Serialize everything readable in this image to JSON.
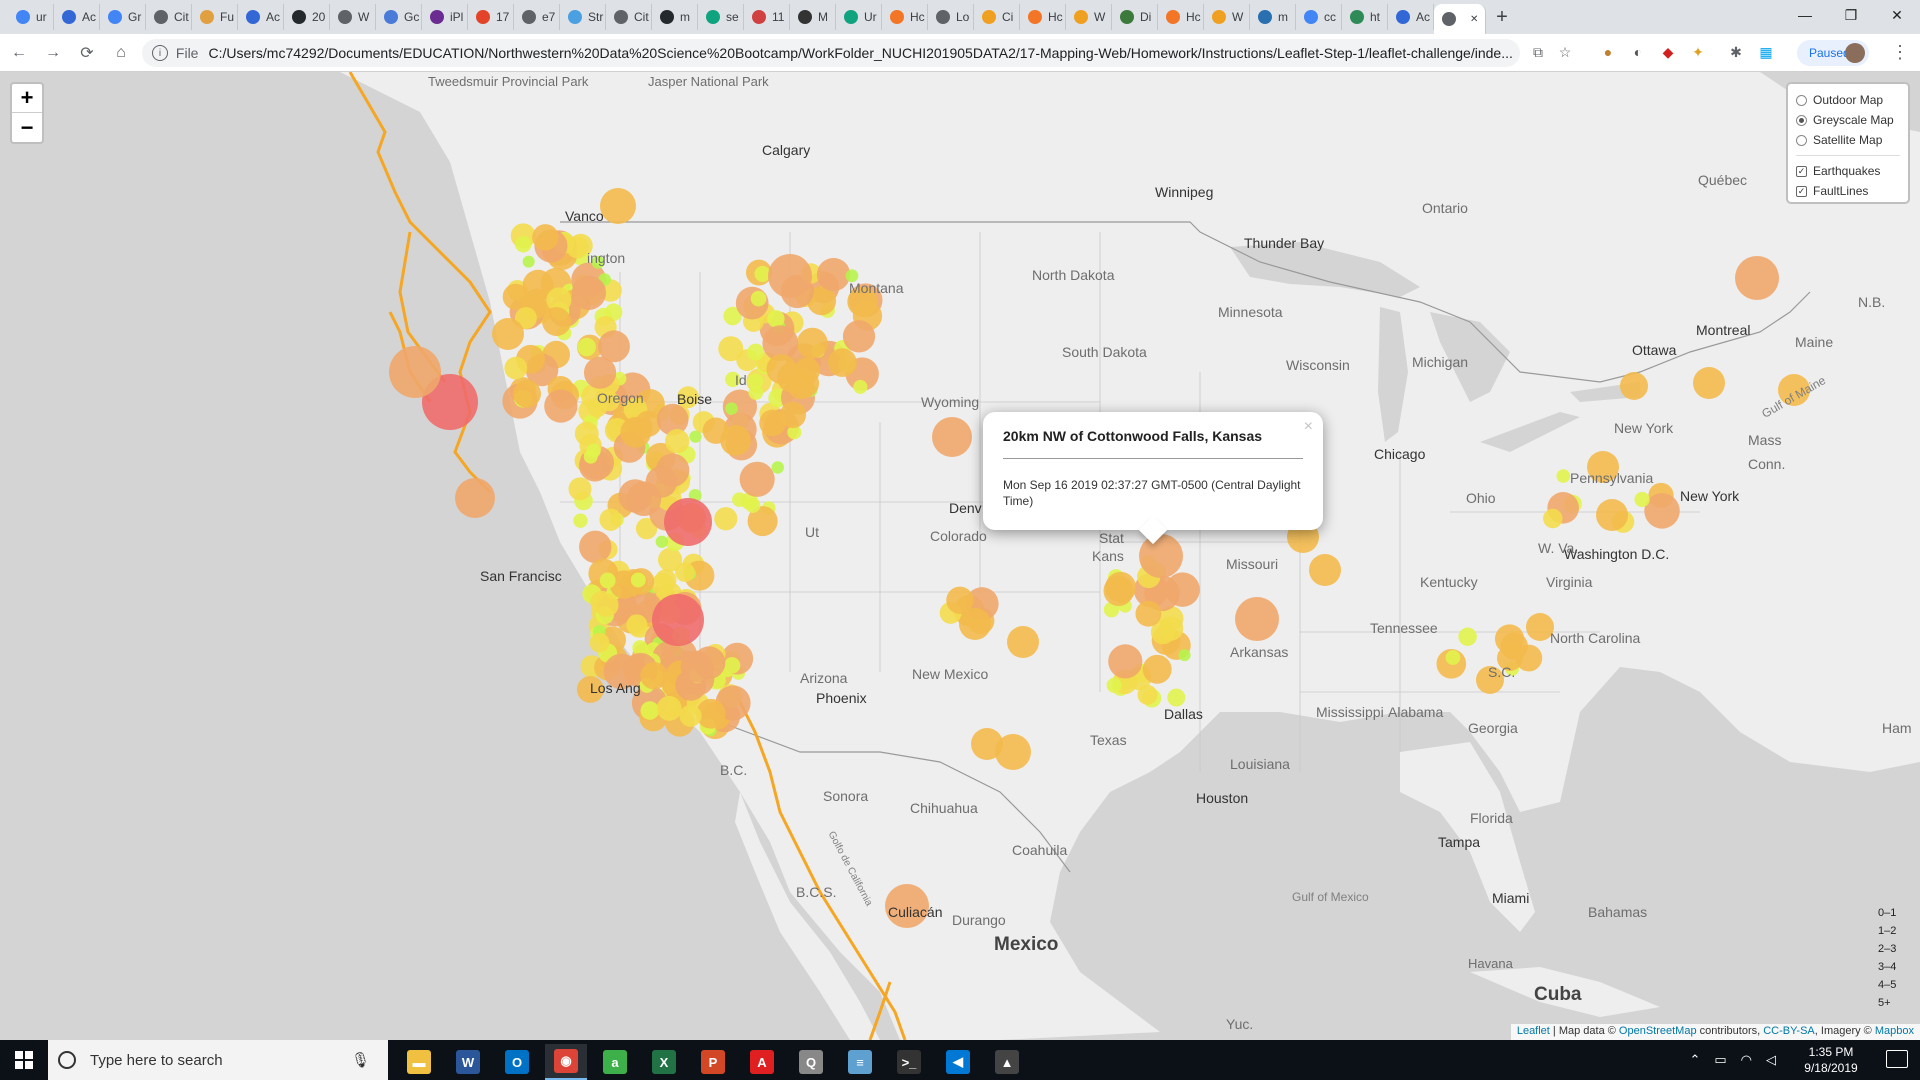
{
  "browser": {
    "tabs": [
      {
        "label": "ur",
        "icon": "google-icon",
        "color": "#4285f4"
      },
      {
        "label": "Ac",
        "icon": "chrome-icon",
        "color": "#3367d6"
      },
      {
        "label": "Gr",
        "icon": "google-icon",
        "color": "#4285f4"
      },
      {
        "label": "Cit",
        "icon": "globe-icon",
        "color": "#5f6368"
      },
      {
        "label": "Fu",
        "icon": "tab-icon",
        "color": "#e0a040"
      },
      {
        "label": "Ac",
        "icon": "chrome-icon",
        "color": "#3367d6"
      },
      {
        "label": "20",
        "icon": "github-icon",
        "color": "#24292e"
      },
      {
        "label": "W",
        "icon": "globe-icon",
        "color": "#5f6368"
      },
      {
        "label": "Gc",
        "icon": "google-docs-icon",
        "color": "#4a7bd8"
      },
      {
        "label": "iPl",
        "icon": "ipl-icon",
        "color": "#6a2c91"
      },
      {
        "label": "17",
        "icon": "gitlab-icon",
        "color": "#e24329"
      },
      {
        "label": "e7",
        "icon": "globe-icon",
        "color": "#5f6368"
      },
      {
        "label": "Str",
        "icon": "chart-icon",
        "color": "#4aa0e0"
      },
      {
        "label": "Cit",
        "icon": "globe-icon",
        "color": "#5f6368"
      },
      {
        "label": "m",
        "icon": "github-icon",
        "color": "#24292e"
      },
      {
        "label": "se",
        "icon": "openai-icon",
        "color": "#10a37f"
      },
      {
        "label": "11",
        "icon": "tab-icon",
        "color": "#d04040"
      },
      {
        "label": "M",
        "icon": "book-icon",
        "color": "#333333"
      },
      {
        "label": "Ur",
        "icon": "openai-icon",
        "color": "#10a37f"
      },
      {
        "label": "Hc",
        "icon": "jupyter-icon",
        "color": "#f37626"
      },
      {
        "label": "Lo",
        "icon": "globe-icon",
        "color": "#5f6368"
      },
      {
        "label": "Ci",
        "icon": "tab-icon",
        "color": "#f0a020"
      },
      {
        "label": "Hc",
        "icon": "jupyter-icon",
        "color": "#f37626"
      },
      {
        "label": "W",
        "icon": "tab-icon",
        "color": "#f0a020"
      },
      {
        "label": "Di",
        "icon": "tab-icon",
        "color": "#3c7a3c"
      },
      {
        "label": "Hc",
        "icon": "jupyter-icon",
        "color": "#f37626"
      },
      {
        "label": "W",
        "icon": "tab-icon",
        "color": "#f0a020"
      },
      {
        "label": "m",
        "icon": "tab-icon",
        "color": "#2a6fb0"
      },
      {
        "label": "cc",
        "icon": "google-icon",
        "color": "#4285f4"
      },
      {
        "label": "ht",
        "icon": "tab-icon",
        "color": "#2e8b57"
      },
      {
        "label": "Ac",
        "icon": "chrome-icon",
        "color": "#3367d6"
      },
      {
        "label": "",
        "icon": "globe-icon",
        "color": "#5f6368"
      }
    ],
    "new_tab": "+",
    "window_controls": {
      "minimize": "—",
      "maximize": "❐",
      "close": "✕"
    },
    "address": {
      "scheme": "File",
      "url": "C:/Users/mc74292/Documents/EDUCATION/Northwestern%20Data%20Science%20Bootcamp/WorkFolder_NUCHI201905DATA2/17-Mapping-Web/Homework/Instructions/Leaflet-Step-1/leaflet-challenge/inde..."
    },
    "profile": {
      "status": "Paused"
    }
  },
  "map": {
    "zoom_in": "+",
    "zoom_out": "−",
    "layer_control": {
      "base_layers": [
        {
          "label": "Outdoor Map",
          "selected": false
        },
        {
          "label": "Greyscale Map",
          "selected": true
        },
        {
          "label": "Satellite Map",
          "selected": false
        }
      ],
      "overlays": [
        {
          "label": "Earthquakes",
          "checked": true
        },
        {
          "label": "FaultLines",
          "checked": true
        }
      ]
    },
    "popup": {
      "title": "20km NW of Cottonwood Falls, Kansas",
      "time": "Mon Sep 16 2019 02:37:27 GMT-0500 (Central Daylight Time)",
      "close": "×"
    },
    "legend": [
      "0–1",
      "1–2",
      "2–3",
      "3–4",
      "4–5",
      "5+"
    ],
    "legend_colors": [
      "#b7f34d",
      "#e1f34d",
      "#f3db4d",
      "#f3ba4d",
      "#f0a76b",
      "#f06b6b"
    ],
    "attribution": {
      "leaflet": "Leaflet",
      "text": " | Map data © ",
      "osm": "OpenStreetMap",
      "contrib": " contributors, ",
      "license": "CC-BY-SA",
      "imagery": ", Imagery © ",
      "mapbox": "Mapbox"
    },
    "labels": {
      "tweedsmuir": "Tweedsmuir Provincial Park",
      "jasper": "Jasper National Park",
      "calgary": "Calgary",
      "winnipeg": "Winnipeg",
      "vancouver": "Vanco",
      "washington": "ington",
      "montana": "Montana",
      "north_dakota": "North Dakota",
      "minnesota": "Minnesota",
      "south_dakota": "South Dakota",
      "wisconsin": "Wisconsin",
      "michigan": "Michigan",
      "thunder_bay": "Thunder Bay",
      "ontario": "Ontario",
      "quebec": "Québec",
      "montreal": "Montreal",
      "ottawa": "Ottawa",
      "maine": "Maine",
      "nb": "N.B.",
      "oregon": "Oregon",
      "boise": "Boise",
      "idaho": "Id",
      "wyoming": "Wyoming",
      "denver": "Denv",
      "colorado": "Colorado",
      "kansas": "Kans",
      "state": "Stat",
      "missouri": "Missouri",
      "chicago": "Chicago",
      "ohio": "Ohio",
      "pennsylvania": "Pennsylvania",
      "new_york_state": "New York",
      "new_york": "New York",
      "mass": "Mass",
      "conn": "Conn.",
      "gulf_maine": "Gulf of Maine",
      "washington_dc": "Washington D.C.",
      "wva": "W. Va.",
      "virginia": "Virginia",
      "kentucky": "Kentucky",
      "tennessee": "Tennessee",
      "north_carolina": "North Carolina",
      "sc": "S.C.",
      "georgia": "Georgia",
      "arkansas": "Arkansas",
      "mississippi": "Mississippi",
      "alabama": "Alabama",
      "louisiana": "Louisiana",
      "dallas": "Dallas",
      "houston": "Houston",
      "texas": "Texas",
      "new_mexico": "New Mexico",
      "arizona": "Arizona",
      "phoenix": "Phoenix",
      "san_francisco": "San Francisc",
      "los_angeles": "Los Ang",
      "bc": "B.C.",
      "bcs": "B.C.S.",
      "sonora": "Sonora",
      "chihuahua": "Chihuahua",
      "coahuila": "Coahuila",
      "culiacan": "Culiacán",
      "durango": "Durango",
      "mexico": "Mexico",
      "tampa": "Tampa",
      "florida": "Florida",
      "miami": "Miami",
      "bahamas": "Bahamas",
      "havana": "Havana",
      "cuba": "Cuba",
      "gulf_mexico": "Gulf of Mexico",
      "ham": "Ham",
      "yuc": "Yuc.",
      "utah": "Ut",
      "gulf_california": "Golfo de California"
    }
  },
  "taskbar": {
    "search_placeholder": "Type here to search",
    "time": "1:35 PM",
    "date": "9/18/2019",
    "apps": [
      {
        "name": "file-explorer-icon",
        "color": "#f0c040",
        "glyph": "▬"
      },
      {
        "name": "word-icon",
        "color": "#2b579a",
        "glyph": "W"
      },
      {
        "name": "outlook-icon",
        "color": "#0072c6",
        "glyph": "O"
      },
      {
        "name": "chrome-icon",
        "color": "#db4437",
        "glyph": "◉"
      },
      {
        "name": "anaconda-icon",
        "color": "#3eb049",
        "glyph": "a"
      },
      {
        "name": "excel-icon",
        "color": "#217346",
        "glyph": "X"
      },
      {
        "name": "powerpoint-icon",
        "color": "#d24726",
        "glyph": "P"
      },
      {
        "name": "acrobat-icon",
        "color": "#e02020",
        "glyph": "A"
      },
      {
        "name": "sql-icon",
        "color": "#888888",
        "glyph": "Q"
      },
      {
        "name": "notes-icon",
        "color": "#5ea0d0",
        "glyph": "≡"
      },
      {
        "name": "terminal-icon",
        "color": "#333333",
        "glyph": ">_"
      },
      {
        "name": "vscode-icon",
        "color": "#0078d4",
        "glyph": "◀"
      },
      {
        "name": "photos-icon",
        "color": "#444444",
        "glyph": "▲"
      }
    ]
  }
}
